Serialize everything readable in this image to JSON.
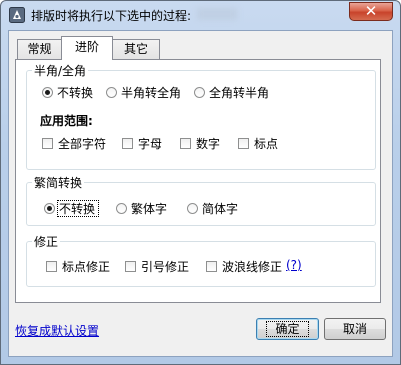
{
  "window": {
    "title": "排版时将执行以下选中的过程:"
  },
  "title_close_glyph": "✕",
  "tabs": [
    {
      "label": "常规",
      "active": false
    },
    {
      "label": "进阶",
      "active": true
    },
    {
      "label": "其它",
      "active": false
    }
  ],
  "halfwidth": {
    "legend": "半角/全角",
    "options": [
      "不转换",
      "半角转全角",
      "全角转半角"
    ],
    "selected": "不转换",
    "scope_label": "应用范围:",
    "scope_items": [
      "全部字符",
      "字母",
      "数字",
      "标点"
    ]
  },
  "trad_simp": {
    "legend": "繁简转换",
    "options": [
      "不转换",
      "繁体字",
      "简体字"
    ],
    "selected": "不转换"
  },
  "correct": {
    "legend": "修正",
    "items": [
      "标点修正",
      "引号修正",
      "波浪线修正"
    ],
    "help_link": "(?)"
  },
  "footer": {
    "restore_link": "恢复成默认设置",
    "ok_label": "确定",
    "cancel_label": "取消"
  },
  "colors": {
    "link": "#0000cc",
    "close_button": "#c8432b"
  }
}
